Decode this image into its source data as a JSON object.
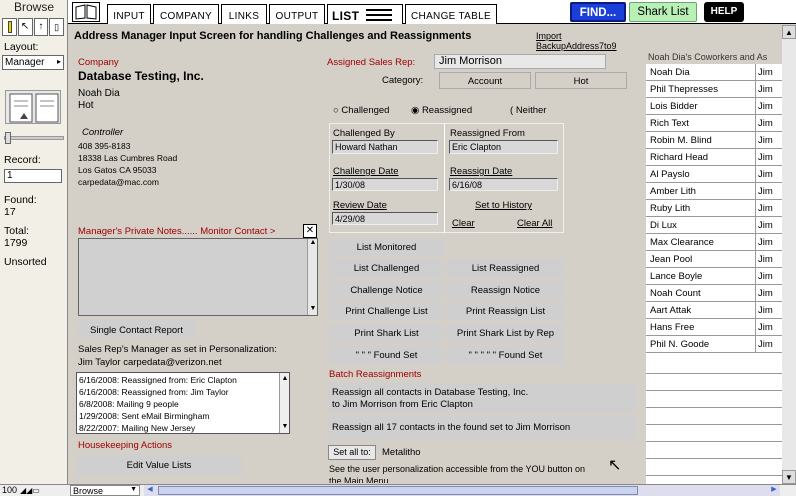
{
  "status": {
    "mode": "Browse",
    "layout_label": "Layout:",
    "layout_value": "Manager",
    "record_label": "Record:",
    "record_value": "1",
    "found_label": "Found:",
    "found_value": "17",
    "total_label": "Total:",
    "total_value": "1799",
    "sort_state": "Unsorted",
    "zoom": "100",
    "mode_select": "Browse"
  },
  "tabs": [
    "INPUT",
    "COMPANY",
    "LINKS",
    "OUTPUT",
    "LIST",
    "CHANGE TABLE"
  ],
  "top_buttons": {
    "find": "FIND...",
    "shark": "Shark List",
    "help": "HELP"
  },
  "header": {
    "title": "Address Manager Input Screen for handling Challenges and Reassignments",
    "import_link": "Import BackupAddress7to9"
  },
  "company": {
    "label": "Company",
    "name": "Database Testing, Inc.",
    "contact": "Noah Dia",
    "status": "Hot",
    "role": "Controller",
    "phone": "408 395-8183",
    "street": "18338 Las Cumbres Road",
    "city": "Los Gatos CA 95033",
    "email": "carpedata@mac.com"
  },
  "notes": {
    "private_label": "Manager's Private Notes...... Monitor Contact >",
    "single_report": "Single Contact Report",
    "manager_label": "Sales Rep's Manager as set in Personalization:",
    "manager_value": "Jim Taylor carpedata@verizon.net",
    "history": [
      "6/16/2008: Reassigned from: Eric Clapton",
      "6/16/2008: Reassigned from: Jim Taylor",
      "6/8/2008: Mailing  9 people",
      "1/29/2008: Sent eMail Birmingham",
      "8/22/2007: Mailing New Jersey"
    ],
    "housekeeping_label": "Housekeeping Actions",
    "edit_value_lists": "Edit Value Lists"
  },
  "assignment": {
    "rep_label": "Assigned Sales Rep:",
    "rep_value": "Jim Morrison",
    "category_label": "Category:",
    "category_account": "Account",
    "category_hot": "Hot",
    "radio_challenged": "Challenged",
    "radio_reassigned": "Reassigned",
    "radio_neither": "Neither",
    "challenged_by_label": "Challenged By",
    "challenged_by_value": "Howard Nathan",
    "challenge_date_label": "Challenge Date",
    "challenge_date_value": "1/30/08",
    "review_date_label": "Review Date",
    "review_date_value": "4/29/08",
    "reassigned_from_label": "Reassigned From",
    "reassigned_from_value": "Eric Clapton",
    "reassign_date_label": "Reassign Date",
    "reassign_date_value": "6/16/08",
    "set_history": "Set to History",
    "clear": "Clear",
    "clear_all": "Clear All"
  },
  "list_buttons": {
    "list_monitored": "List Monitored",
    "list_challenged": "List Challenged",
    "list_reassigned": "List Reassigned",
    "challenge_notice": "Challenge Notice",
    "reassign_notice": "Reassign Notice",
    "print_challenge_list": "Print Challenge List",
    "print_reassign_list": "Print Reassign List",
    "print_shark_list": "Print Shark List",
    "print_shark_by_rep": "Print Shark List by Rep",
    "found_set_1": "\" \" \" Found Set",
    "found_set_2": "\" \" \" \" \" Found Set"
  },
  "batch": {
    "label": "Batch Reassignments",
    "reassign_all_line1": "Reassign all contacts in Database Testing, Inc.",
    "reassign_all_line2": "to Jim Morrison from Eric Clapton",
    "reassign_found": "Reassign all 17 contacts in the found set to Jim Morrison",
    "set_all_to": "Set all to:",
    "set_all_value": "Metalitho",
    "note": "See the user personalization accessible from the YOU button on",
    "note2": "the Main Menu"
  },
  "coworkers": {
    "title": "Noah Dia's Coworkers and As",
    "rows": [
      {
        "name": "Noah Dia",
        "rep": "Jim"
      },
      {
        "name": "Phil Thepresses",
        "rep": "Jim"
      },
      {
        "name": "Lois Bidder",
        "rep": "Jim"
      },
      {
        "name": "Rich Text",
        "rep": "Jim"
      },
      {
        "name": "Robin M. Blind",
        "rep": "Jim"
      },
      {
        "name": "Richard Head",
        "rep": "Jim"
      },
      {
        "name": "Al Payslo",
        "rep": "Jim"
      },
      {
        "name": "Amber Lith",
        "rep": "Jim"
      },
      {
        "name": "Ruby Lith",
        "rep": "Jim"
      },
      {
        "name": "Di Lux",
        "rep": "Jim"
      },
      {
        "name": "Max Clearance",
        "rep": "Jim"
      },
      {
        "name": "Jean Pool",
        "rep": "Jim"
      },
      {
        "name": "Lance Boyle",
        "rep": "Jim"
      },
      {
        "name": "Noah Count",
        "rep": "Jim"
      },
      {
        "name": "Aart Attak",
        "rep": "Jim"
      },
      {
        "name": "Hans Free",
        "rep": "Jim"
      },
      {
        "name": "Phil N. Goode",
        "rep": "Jim"
      }
    ]
  },
  "colors": {
    "find_bg": "#1a3fd8",
    "shark_bg": "#b8f0b8",
    "help_bg": "#000000",
    "label_red": "#a00000"
  }
}
